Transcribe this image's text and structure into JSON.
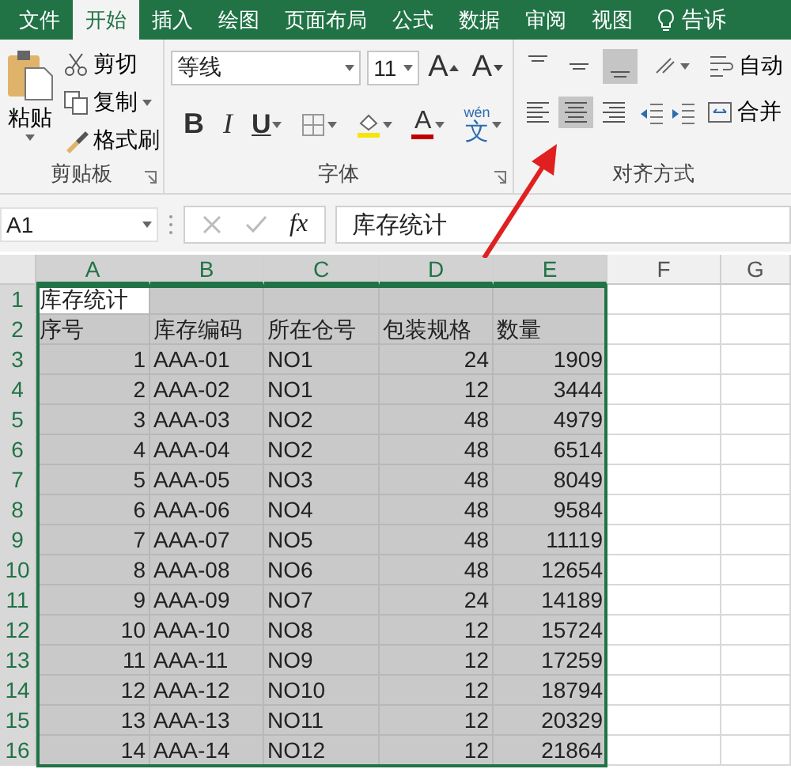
{
  "tabs": [
    {
      "label": "文件",
      "selected": false
    },
    {
      "label": "开始",
      "selected": true
    },
    {
      "label": "插入",
      "selected": false
    },
    {
      "label": "绘图",
      "selected": false
    },
    {
      "label": "页面布局",
      "selected": false
    },
    {
      "label": "公式",
      "selected": false
    },
    {
      "label": "数据",
      "selected": false
    },
    {
      "label": "审阅",
      "selected": false
    },
    {
      "label": "视图",
      "selected": false
    }
  ],
  "tell_me": "告诉",
  "clipboard": {
    "label": "剪贴板",
    "paste": "粘贴",
    "cut": "剪切",
    "copy": "复制",
    "format_painter": "格式刷"
  },
  "font": {
    "label": "字体",
    "name": "等线",
    "size": "11",
    "grow": "A",
    "shrink": "A",
    "bold": "B",
    "italic": "I",
    "underline": "U",
    "font_color": "A",
    "phonetic_top": "wén",
    "phonetic_char": "文"
  },
  "alignment": {
    "label": "对齐方式",
    "vertical": [
      {
        "kind": "top",
        "selected": false
      },
      {
        "kind": "middle",
        "selected": false
      },
      {
        "kind": "bottom",
        "selected": true
      }
    ],
    "horizontal": [
      {
        "kind": "left",
        "selected": false
      },
      {
        "kind": "center",
        "selected": true
      },
      {
        "kind": "right",
        "selected": false
      }
    ],
    "wrap_text": "自动",
    "merge": "合并"
  },
  "formula_bar": {
    "name_box": "A1",
    "fx": "fx",
    "content": "库存统计"
  },
  "sheet": {
    "columns": [
      {
        "label": "A",
        "selected": true
      },
      {
        "label": "B",
        "selected": true
      },
      {
        "label": "C",
        "selected": true
      },
      {
        "label": "D",
        "selected": true
      },
      {
        "label": "E",
        "selected": true
      },
      {
        "label": "F",
        "selected": false
      },
      {
        "label": "G",
        "selected": false
      }
    ],
    "rows": [
      {
        "number": "1",
        "kind": "title",
        "selected": true,
        "cells": [
          "库存统计"
        ]
      },
      {
        "number": "2",
        "kind": "header",
        "selected": true,
        "cells": [
          "序号",
          "库存编码",
          "所在仓号",
          "包装规格",
          "数量"
        ]
      },
      {
        "number": "3",
        "kind": "data",
        "selected": true,
        "cells": [
          "1",
          "AAA-01",
          "NO1",
          "24",
          "1909"
        ]
      },
      {
        "number": "4",
        "kind": "data",
        "selected": true,
        "cells": [
          "2",
          "AAA-02",
          "NO1",
          "12",
          "3444"
        ]
      },
      {
        "number": "5",
        "kind": "data",
        "selected": true,
        "cells": [
          "3",
          "AAA-03",
          "NO2",
          "48",
          "4979"
        ]
      },
      {
        "number": "6",
        "kind": "data",
        "selected": true,
        "cells": [
          "4",
          "AAA-04",
          "NO2",
          "48",
          "6514"
        ]
      },
      {
        "number": "7",
        "kind": "data",
        "selected": true,
        "cells": [
          "5",
          "AAA-05",
          "NO3",
          "48",
          "8049"
        ]
      },
      {
        "number": "8",
        "kind": "data",
        "selected": true,
        "cells": [
          "6",
          "AAA-06",
          "NO4",
          "48",
          "9584"
        ]
      },
      {
        "number": "9",
        "kind": "data",
        "selected": true,
        "cells": [
          "7",
          "AAA-07",
          "NO5",
          "48",
          "11119"
        ]
      },
      {
        "number": "10",
        "kind": "data",
        "selected": true,
        "cells": [
          "8",
          "AAA-08",
          "NO6",
          "48",
          "12654"
        ]
      },
      {
        "number": "11",
        "kind": "data",
        "selected": true,
        "cells": [
          "9",
          "AAA-09",
          "NO7",
          "24",
          "14189"
        ]
      },
      {
        "number": "12",
        "kind": "data",
        "selected": true,
        "cells": [
          "10",
          "AAA-10",
          "NO8",
          "12",
          "15724"
        ]
      },
      {
        "number": "13",
        "kind": "data",
        "selected": true,
        "cells": [
          "11",
          "AAA-11",
          "NO9",
          "12",
          "17259"
        ]
      },
      {
        "number": "14",
        "kind": "data",
        "selected": true,
        "cells": [
          "12",
          "AAA-12",
          "NO10",
          "12",
          "18794"
        ]
      },
      {
        "number": "15",
        "kind": "data",
        "selected": true,
        "cells": [
          "13",
          "AAA-13",
          "NO11",
          "12",
          "20329"
        ]
      },
      {
        "number": "16",
        "kind": "data",
        "selected": true,
        "cells": [
          "14",
          "AAA-14",
          "NO12",
          "12",
          "21864"
        ]
      }
    ]
  }
}
